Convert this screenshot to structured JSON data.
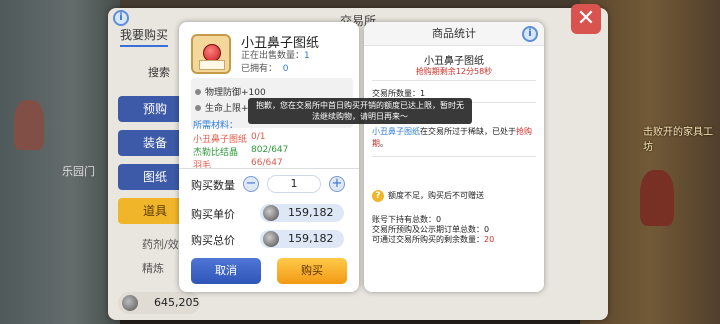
{
  "exchange_window": {
    "title": "交易所",
    "tab_buy": "我要购买",
    "search_label": "搜索",
    "side_buttons": [
      "预购",
      "装备",
      "图纸",
      "道具"
    ],
    "side_labels": [
      "药剂/效",
      "精炼"
    ],
    "coins": "645,205",
    "left_label": "乐园门",
    "right_label": "击败开的家具工坊"
  },
  "detail": {
    "item_name": "小丑鼻子图纸",
    "on_sale_label": "正在出售数量：",
    "on_sale_value": "1",
    "owned_label": "已拥有：",
    "owned_value": "0",
    "stats": [
      "物理防御+100",
      "生命上限+"
    ],
    "materials_title": "所需材料：",
    "materials": [
      {
        "name": "小丑鼻子图纸",
        "count": "0/1",
        "color": "#e05a4a"
      },
      {
        "name": "杰勒比结晶",
        "count": "802/647",
        "color": "#2e9a3c"
      },
      {
        "name": "羽毛",
        "count": "66/647",
        "color": "#e05a4a"
      }
    ],
    "qty_label": "购买数量",
    "qty_value": "1",
    "unit_price_label": "购买单价",
    "unit_price": "159,182",
    "total_price_label": "购买总价",
    "total_price": "159,182",
    "cancel_label": "取消",
    "buy_label": "购买"
  },
  "statistics": {
    "header": "商品统计",
    "item_name": "小丑鼻子图纸",
    "limit_text": "抢购期剩余12分58秒",
    "quantity_label": "交易所数量：1",
    "desc_part1": "小丑鼻子图纸",
    "desc_part2": "在交易所过于稀缺，已处于",
    "desc_part3": "抢购期",
    "desc_part4": "。",
    "warning": "额度不足，购买后不可赠送",
    "lines": [
      {
        "label": "账号下持有总数：",
        "value": "0"
      },
      {
        "label": "交易所预购及公示期订单总数：",
        "value": "0"
      },
      {
        "label": "可通过交易所购买的剩余数量：",
        "value": "20"
      }
    ]
  },
  "toast": {
    "line1": "抱歉，您在交易所中首日购买开销的额度已达上限，暂时无",
    "line2": "法继续购物，请明日再来～"
  },
  "colors": {
    "accent_blue": "#2f7de1",
    "alert_red": "#d0302a",
    "buy_orange": "#f29a14",
    "cancel_blue": "#2f55b6"
  }
}
